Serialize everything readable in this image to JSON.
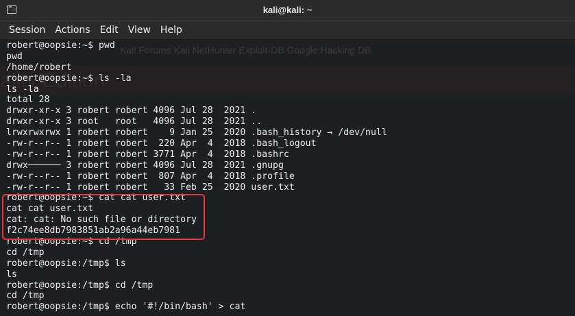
{
  "window": {
    "title": "kali@kali: ~"
  },
  "menu": [
    "Session",
    "Actions",
    "Edit",
    "View",
    "Help"
  ],
  "background_ghost": {
    "bookmarks": "Kali Forums    Kali NetHunter    Exploit-DB    Google Hacking DB",
    "edition": "ality Edition"
  },
  "terminal_lines": [
    "robert@oopsie:~$ pwd",
    "pwd",
    "/home/robert",
    "robert@oopsie:~$ ls -la",
    "ls -la",
    "total 28",
    "drwxr-xr-x 3 robert robert 4096 Jul 28  2021 .",
    "drwxr-xr-x 3 root   root   4096 Jul 28  2021 ..",
    "lrwxrwxrwx 1 robert robert    9 Jan 25  2020 .bash_history → /dev/null",
    "-rw-r--r-- 1 robert robert  220 Apr  4  2018 .bash_logout",
    "-rw-r--r-- 1 robert robert 3771 Apr  4  2018 .bashrc",
    "drwx────── 3 robert robert 4096 Jul 28  2021 .gnupg",
    "-rw-r--r-- 1 robert robert  807 Apr  4  2018 .profile",
    "-rw-r--r-- 1 robert robert   33 Feb 25  2020 user.txt",
    "robert@oopsie:~$ cat cat user.txt",
    "cat cat user.txt",
    "cat: cat: No such file or directory",
    "f2c74ee8db7983851ab2a96a44eb7981",
    "robert@oopsie:~$ cd /tmp",
    "cd /tmp",
    "robert@oopsie:/tmp$ ls",
    "ls",
    "robert@oopsie:/tmp$ cd /tmp",
    "cd /tmp",
    "robert@oopsie:/tmp$ echo '#!/bin/bash' > cat"
  ],
  "colors": {
    "highlight_border": "#e0393e",
    "terminal_bg": "#1e1f22",
    "text": "#ececec"
  }
}
